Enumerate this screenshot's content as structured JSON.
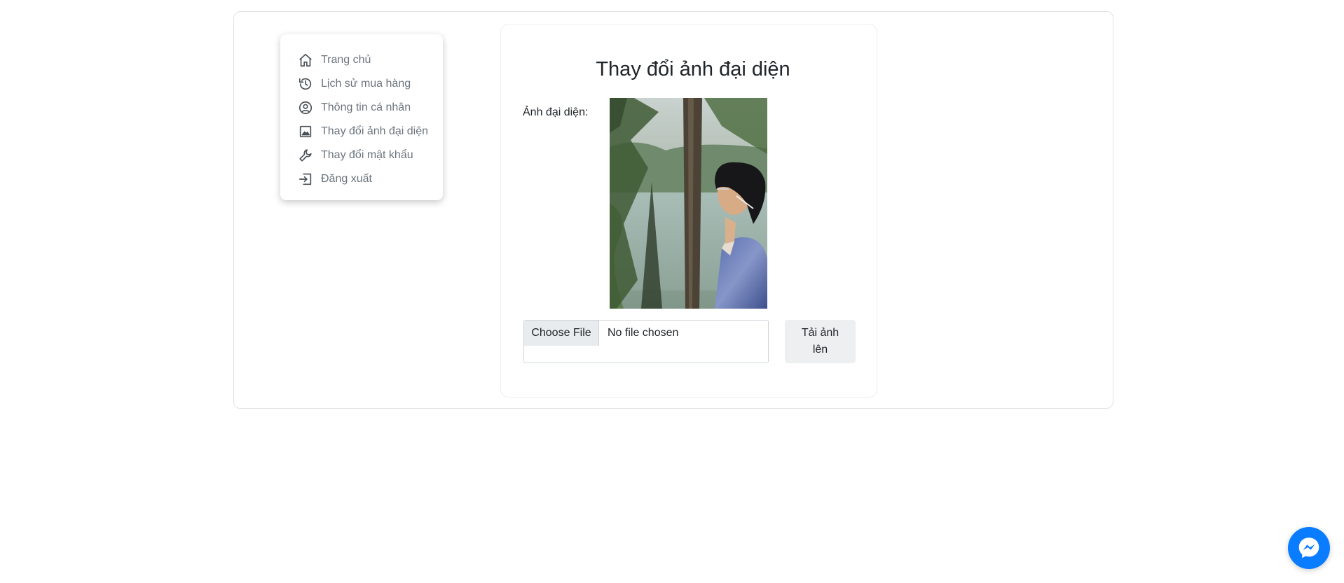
{
  "sidebar": {
    "items": [
      {
        "label": "Trang chủ",
        "icon": "home-icon"
      },
      {
        "label": "Lịch sử mua hàng",
        "icon": "history-icon"
      },
      {
        "label": "Thông tin cá nhân",
        "icon": "user-circle-icon"
      },
      {
        "label": "Thay đổi ảnh đại diện",
        "icon": "image-icon"
      },
      {
        "label": "Thay đổi mật khẩu",
        "icon": "wrench-icon"
      },
      {
        "label": "Đăng xuất",
        "icon": "logout-icon"
      }
    ]
  },
  "main": {
    "title": "Thay đổi ảnh đại diện",
    "avatar_label": "Ảnh đại diện:",
    "file_input": {
      "button_label": "Choose File",
      "status": "No file chosen"
    },
    "upload_button": "Tải ảnh lên"
  },
  "floating": {
    "icon": "messenger-icon"
  },
  "colors": {
    "messenger_blue": "#0a7cff",
    "menu_text": "#6c757d"
  }
}
